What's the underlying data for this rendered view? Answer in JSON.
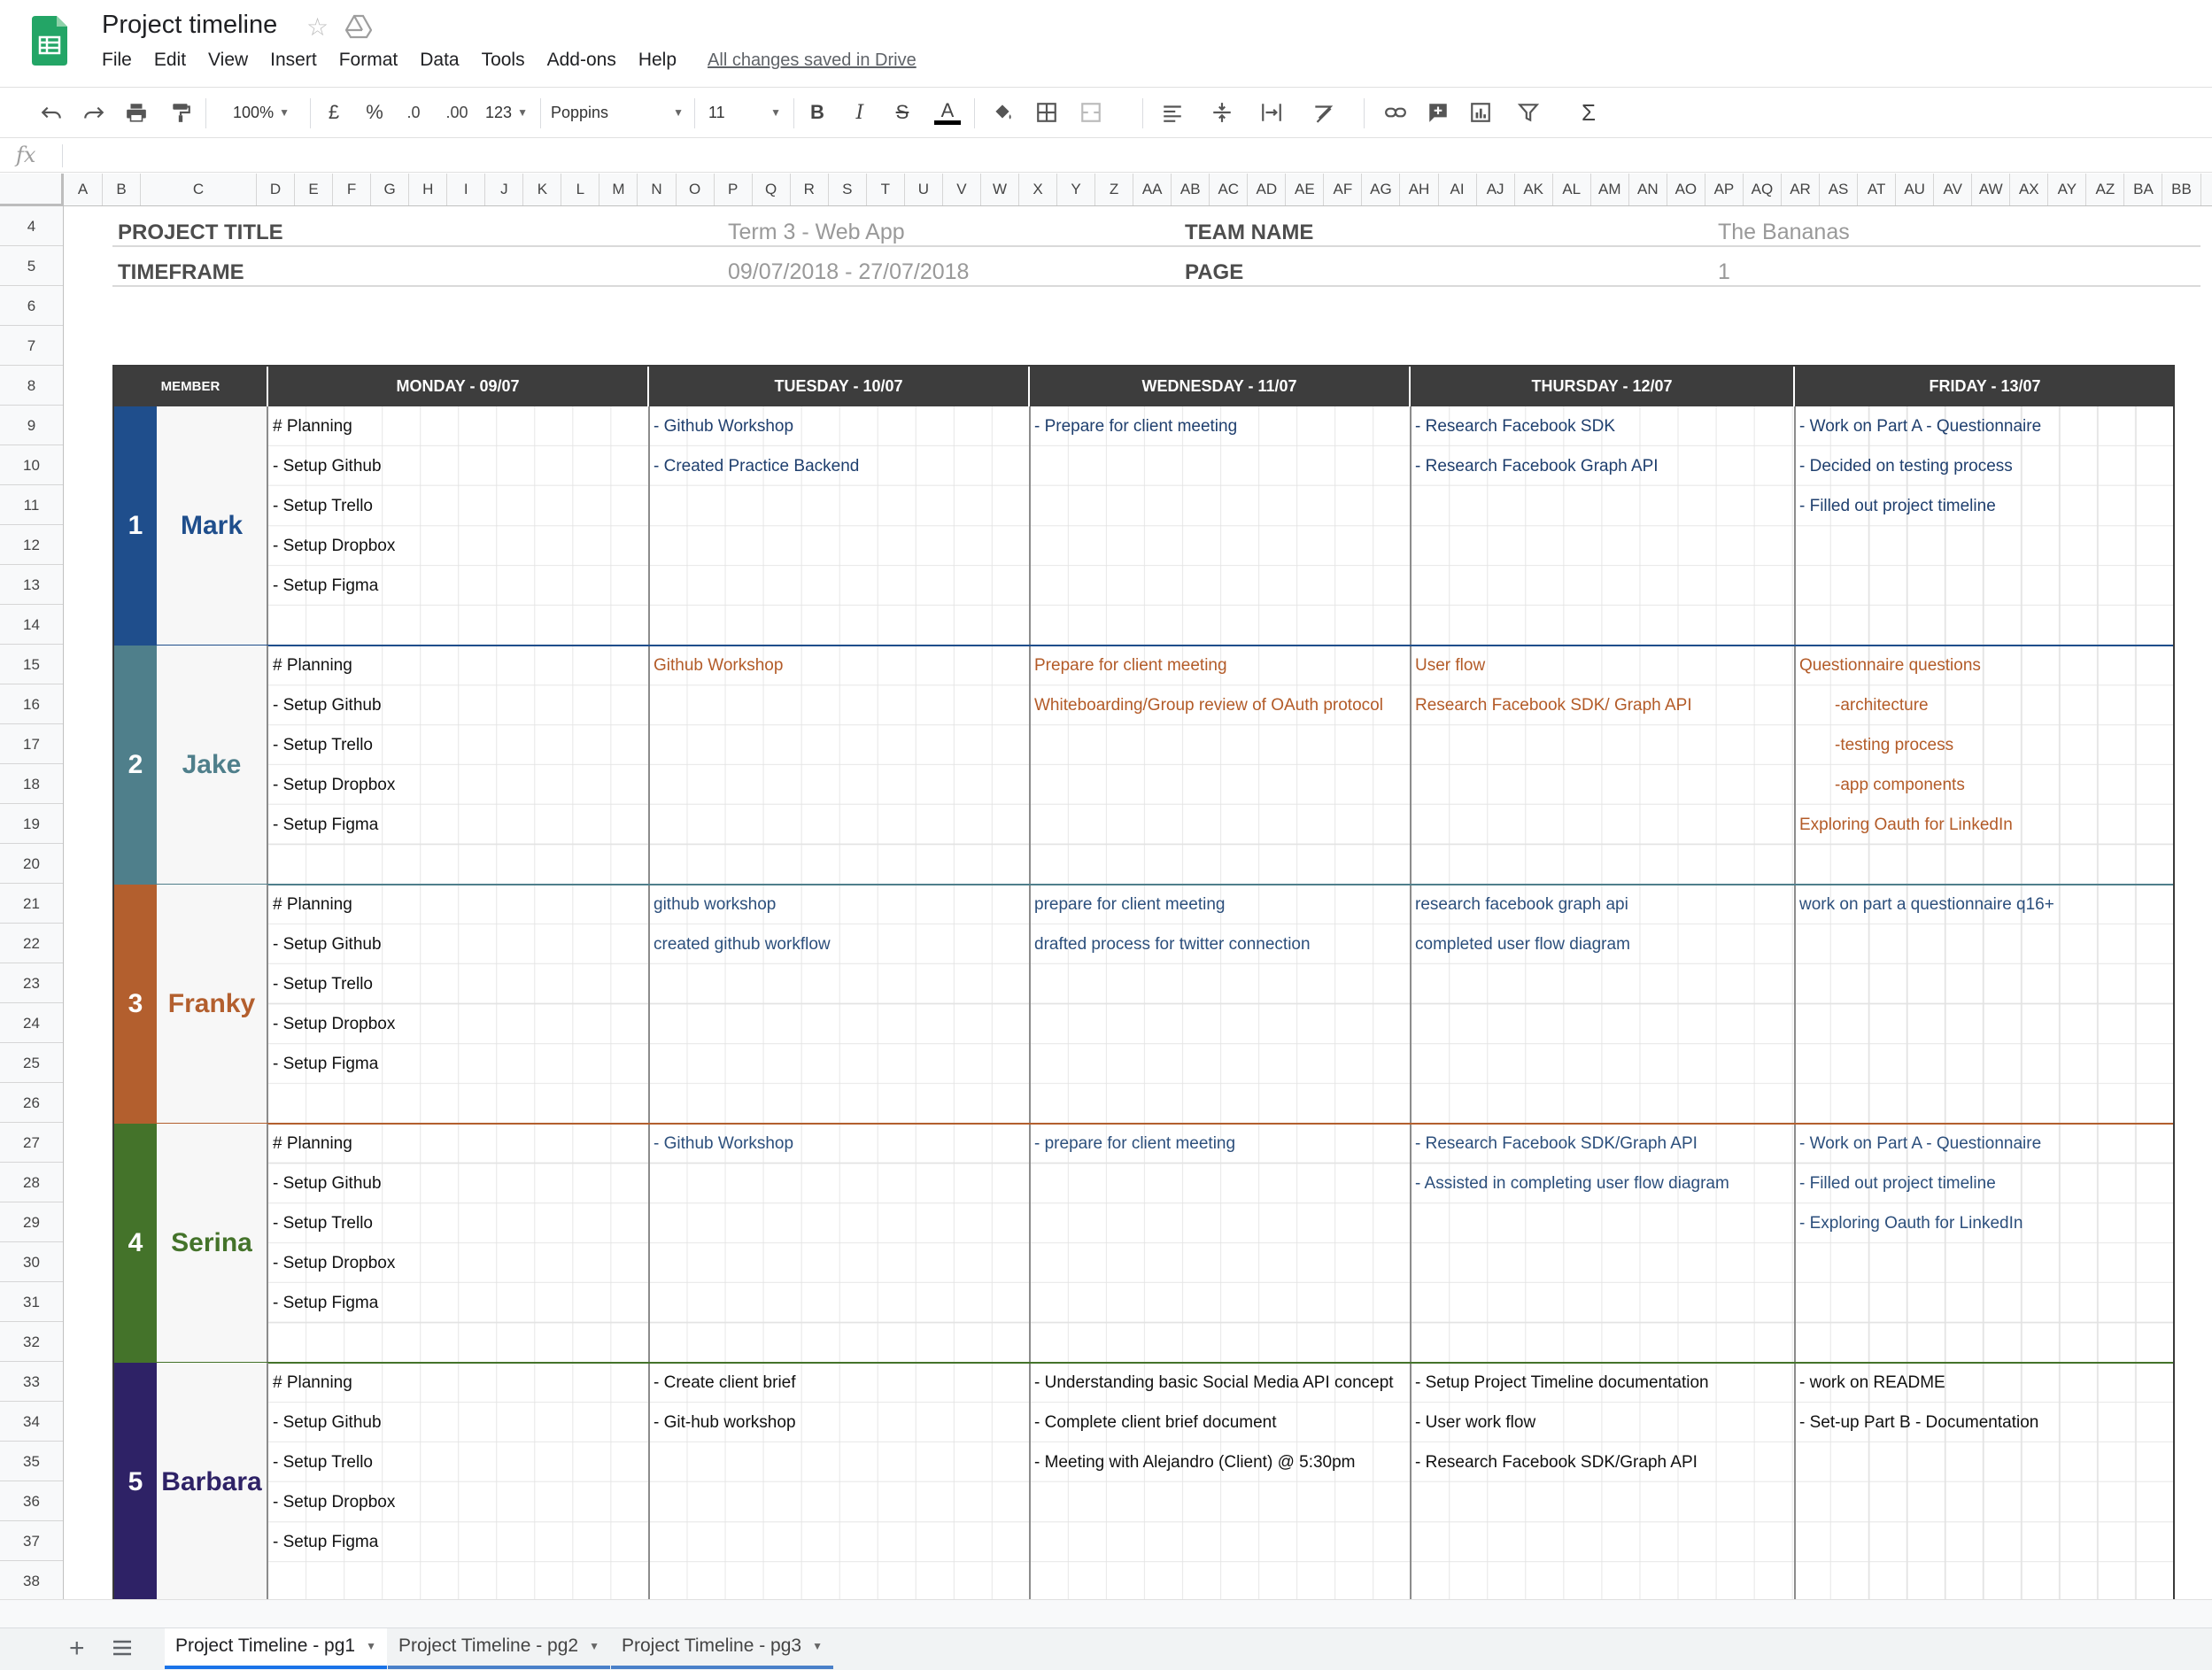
{
  "app": {
    "title": "Project timeline",
    "save_status": "All changes saved in Drive"
  },
  "menu": [
    "File",
    "Edit",
    "View",
    "Insert",
    "Format",
    "Data",
    "Tools",
    "Add-ons",
    "Help"
  ],
  "toolbar": {
    "zoom": "100%",
    "currency": "£",
    "percent": "%",
    "decrease_decimals": ".0",
    "increase_decimals": ".00",
    "more_formats": "123",
    "font": "Poppins",
    "font_size": "11",
    "bold": "B",
    "italic": "I",
    "strikethrough": "S",
    "text_color": "A",
    "functions": "Σ"
  },
  "formula_bar": {
    "icon": "fx"
  },
  "columns": [
    "A",
    "B",
    "C",
    "D",
    "E",
    "F",
    "G",
    "H",
    "I",
    "J",
    "K",
    "L",
    "M",
    "N",
    "O",
    "P",
    "Q",
    "R",
    "S",
    "T",
    "U",
    "V",
    "W",
    "X",
    "Y",
    "Z",
    "AA",
    "AB",
    "AC",
    "AD",
    "AE",
    "AF",
    "AG",
    "AH",
    "AI",
    "AJ",
    "AK",
    "AL",
    "AM",
    "AN",
    "AO",
    "AP",
    "AQ",
    "AR",
    "AS",
    "AT",
    "AU",
    "AV",
    "AW",
    "AX",
    "AY",
    "AZ",
    "BA",
    "BB"
  ],
  "rows": [
    "4",
    "5",
    "6",
    "7",
    "8",
    "9",
    "10",
    "11",
    "12",
    "13",
    "14",
    "15",
    "16",
    "17",
    "18",
    "19",
    "20",
    "21",
    "22",
    "23",
    "24",
    "25",
    "26",
    "27",
    "28",
    "29",
    "30",
    "31",
    "32",
    "33",
    "34",
    "35",
    "36",
    "37",
    "38"
  ],
  "info": {
    "project_title_label": "PROJECT TITLE",
    "project_title_value": "Term 3 - Web App",
    "team_name_label": "TEAM NAME",
    "team_name_value": "The Bananas",
    "timeframe_label": "TIMEFRAME",
    "timeframe_value": "09/07/2018 - 27/07/2018",
    "page_label": "PAGE",
    "page_value": "1"
  },
  "timeline": {
    "member_header": "MEMBER",
    "days": [
      "MONDAY - 09/07",
      "TUESDAY - 10/07",
      "WEDNESDAY - 11/07",
      "THURSDAY - 12/07",
      "FRIDAY - 13/07"
    ],
    "members": [
      {
        "number": "1",
        "name": "Mark",
        "color": "#1f4e8c",
        "name_color": "#1f4e8c",
        "task_color": "#1f3f6e",
        "tasks": [
          [
            "# Planning",
            "- Setup Github",
            "- Setup Trello",
            "- Setup Dropbox",
            "- Setup Figma"
          ],
          [
            "- Github Workshop",
            "- Created Practice Backend"
          ],
          [
            "- Prepare for client meeting"
          ],
          [
            "- Research Facebook SDK",
            "- Research Facebook Graph API"
          ],
          [
            "- Work on Part A - Questionnaire",
            "- Decided on testing process",
            "- Filled out project timeline"
          ]
        ]
      },
      {
        "number": "2",
        "name": "Jake",
        "color": "#4f7f8b",
        "name_color": "#4f7f8b",
        "task_color": "#b35b28",
        "tasks": [
          [
            "# Planning",
            "- Setup Github",
            "- Setup Trello",
            "- Setup Dropbox",
            "- Setup Figma"
          ],
          [
            "Github Workshop"
          ],
          [
            "Prepare for client meeting",
            "Whiteboarding/Group review of OAuth protocol"
          ],
          [
            "User flow",
            "Research Facebook SDK/ Graph API"
          ],
          [
            "Questionnaire questions",
            "-architecture",
            "-testing process",
            "-app components",
            "Exploring Oauth for LinkedIn"
          ]
        ]
      },
      {
        "number": "3",
        "name": "Franky",
        "color": "#b35f2e",
        "name_color": "#b35f2e",
        "task_color": "#2c4f7c",
        "tasks": [
          [
            "# Planning",
            "- Setup Github",
            "- Setup Trello",
            "- Setup Dropbox",
            "- Setup Figma"
          ],
          [
            "github workshop",
            "created github workflow"
          ],
          [
            "prepare for client meeting",
            "drafted process for twitter connection"
          ],
          [
            "research facebook graph api",
            "completed user flow diagram"
          ],
          [
            "work on part a questionnaire q16+"
          ]
        ]
      },
      {
        "number": "4",
        "name": "Serina",
        "color": "#44732a",
        "name_color": "#44732a",
        "task_color": "#2c4f7c",
        "tasks": [
          [
            "# Planning",
            "- Setup Github",
            "- Setup Trello",
            "- Setup Dropbox",
            "- Setup Figma"
          ],
          [
            "- Github Workshop"
          ],
          [
            "- prepare for client meeting"
          ],
          [
            "- Research Facebook SDK/Graph API",
            "- Assisted in completing user flow diagram"
          ],
          [
            "- Work on Part A - Questionnaire",
            "- Filled out project timeline",
            "- Exploring Oauth for LinkedIn"
          ]
        ]
      },
      {
        "number": "5",
        "name": "Barbara",
        "color": "#2e2266",
        "name_color": "#2e2266",
        "task_color": "#111111",
        "tasks": [
          [
            "# Planning",
            "- Setup Github",
            "- Setup Trello",
            "- Setup Dropbox",
            "- Setup Figma"
          ],
          [
            "- Create client brief",
            "- Git-hub workshop"
          ],
          [
            "- Understanding basic Social Media API concept",
            "- Complete client brief document",
            "- Meeting with Alejandro (Client) @ 5:30pm"
          ],
          [
            "- Setup Project Timeline documentation",
            "- User work flow",
            "- Research Facebook SDK/Graph API"
          ],
          [
            "- work on README",
            "- Set-up Part B - Documentation"
          ]
        ]
      }
    ]
  },
  "sheets": [
    "Project Timeline - pg1",
    "Project Timeline - pg2",
    "Project Timeline - pg3"
  ],
  "colors": {
    "header_bg": "#3d3d3d",
    "active_tab": "#1a73e8",
    "sheets_green": "#23a566"
  }
}
